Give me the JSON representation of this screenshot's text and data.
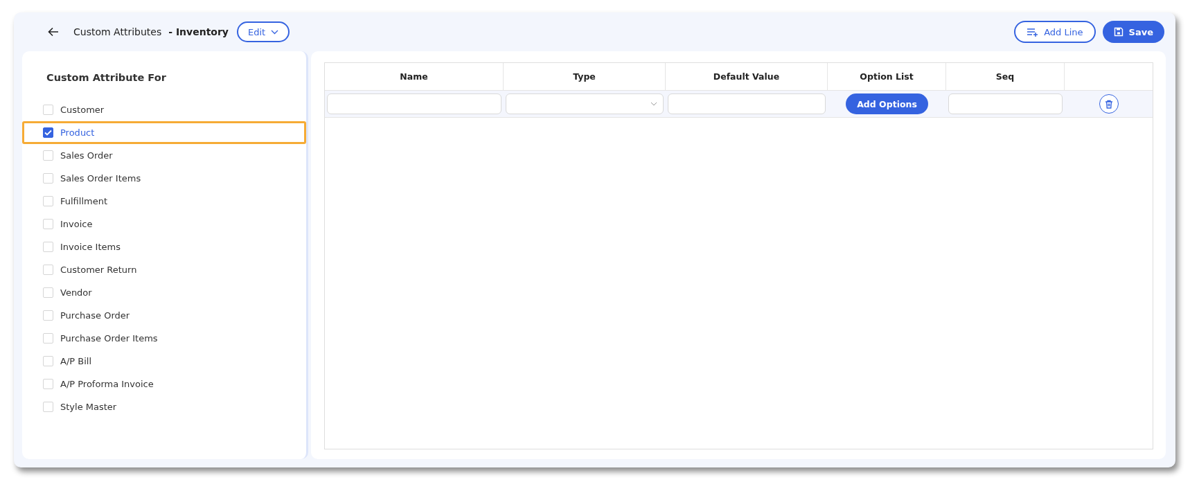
{
  "header": {
    "title": "Custom Attributes",
    "module": "- Inventory",
    "edit_button": "Edit",
    "add_line_button": "Add Line",
    "save_button": "Save"
  },
  "sidebar": {
    "title": "Custom Attribute For",
    "items": [
      {
        "label": "Customer",
        "checked": false,
        "selected": false
      },
      {
        "label": "Product",
        "checked": true,
        "selected": true
      },
      {
        "label": "Sales Order",
        "checked": false,
        "selected": false
      },
      {
        "label": "Sales Order Items",
        "checked": false,
        "selected": false
      },
      {
        "label": "Fulfillment",
        "checked": false,
        "selected": false
      },
      {
        "label": "Invoice",
        "checked": false,
        "selected": false
      },
      {
        "label": "Invoice Items",
        "checked": false,
        "selected": false
      },
      {
        "label": "Customer Return",
        "checked": false,
        "selected": false
      },
      {
        "label": "Vendor",
        "checked": false,
        "selected": false
      },
      {
        "label": "Purchase Order",
        "checked": false,
        "selected": false
      },
      {
        "label": "Purchase Order Items",
        "checked": false,
        "selected": false
      },
      {
        "label": "A/P Bill",
        "checked": false,
        "selected": false
      },
      {
        "label": "A/P Proforma Invoice",
        "checked": false,
        "selected": false
      },
      {
        "label": "Style Master",
        "checked": false,
        "selected": false
      }
    ]
  },
  "table": {
    "columns": [
      "Name",
      "Type",
      "Default Value",
      "Option List",
      "Seq"
    ],
    "rows": [
      {
        "option_button": "Add Options"
      }
    ]
  }
}
